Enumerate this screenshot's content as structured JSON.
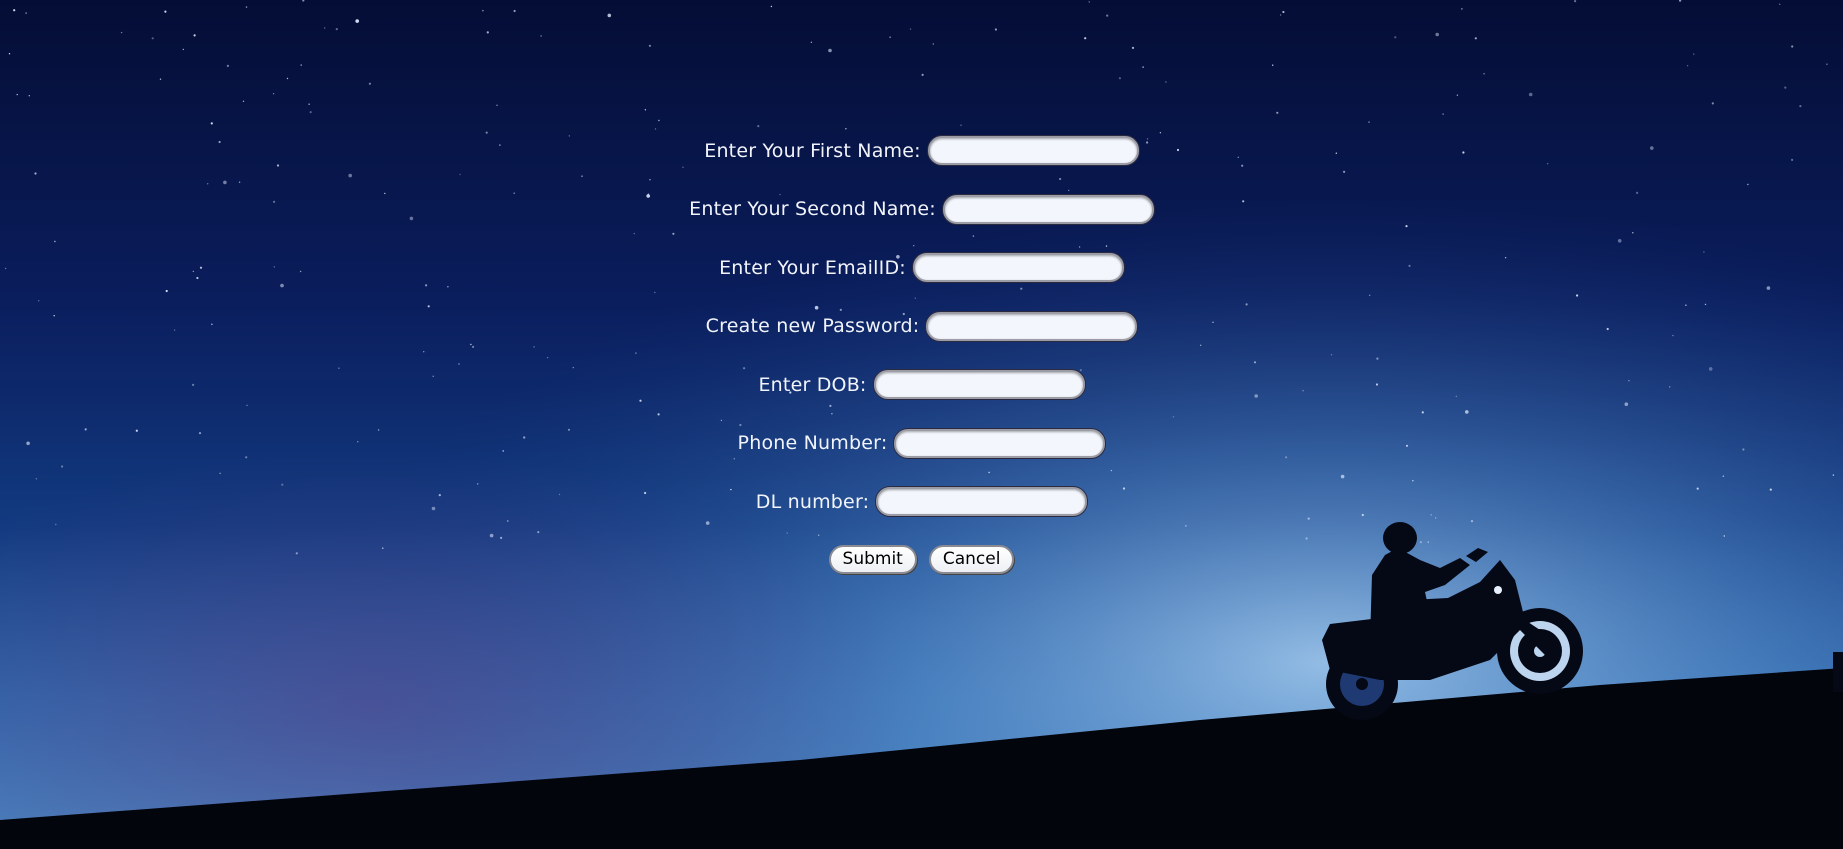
{
  "form": {
    "fields": [
      {
        "label": "Enter Your First Name:",
        "value": ""
      },
      {
        "label": "Enter Your Second Name:",
        "value": ""
      },
      {
        "label": "Enter Your EmailID:",
        "value": ""
      },
      {
        "label": "Create new Password:",
        "value": ""
      },
      {
        "label": "Enter DOB:",
        "value": ""
      },
      {
        "label": "Phone Number:",
        "value": ""
      },
      {
        "label": "DL number:",
        "value": ""
      }
    ],
    "submit_label": "Submit",
    "cancel_label": "Cancel"
  },
  "background": {
    "sky_top_color": "#06103a",
    "sky_mid_color": "#0f2f73",
    "horizon_glow_color": "#7fb0e0",
    "ground_color": "#03050c"
  }
}
